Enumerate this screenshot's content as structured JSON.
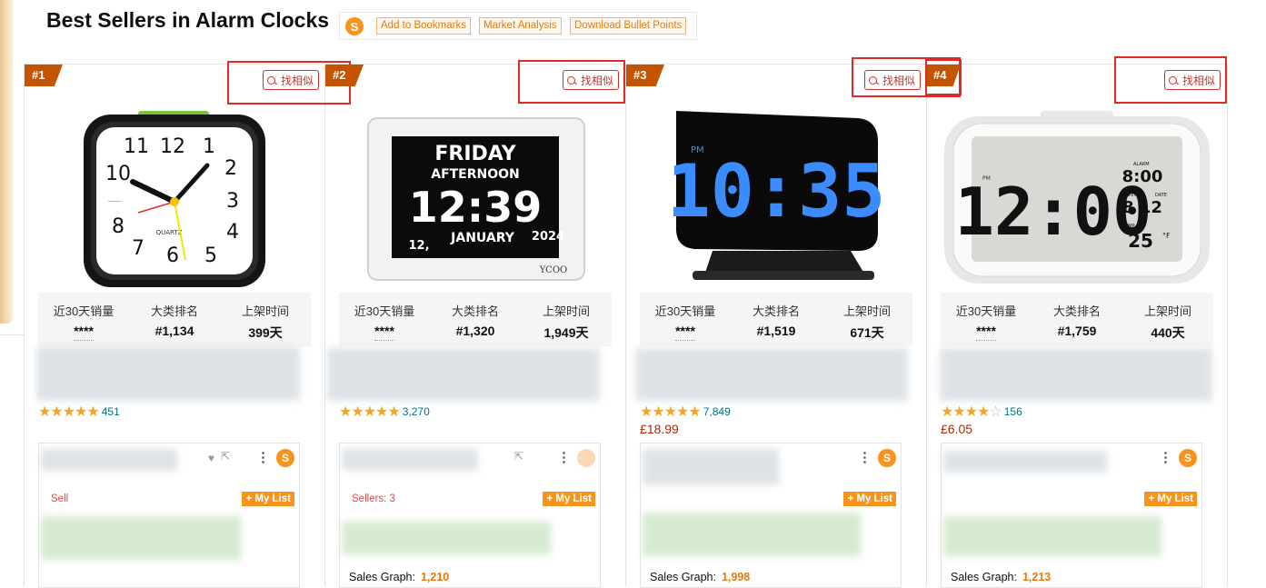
{
  "page": {
    "title": "Best Sellers in Alarm Clocks"
  },
  "toolbar": {
    "logo_icon": "seller-tool-logo-icon",
    "buttons": [
      "Add to Bookmarks",
      "Market Analysis",
      "Download Bullet Points"
    ]
  },
  "colors": {
    "accent_orange": "#f7941d",
    "rank_badge": "#c45500",
    "highlight_red": "#e02b2b",
    "price_red": "#b12704",
    "star_color": "#f5a623"
  },
  "stat_labels": [
    "近30天销量",
    "大类排名",
    "上架时间"
  ],
  "similar_label": "找相似",
  "sales_graph_label": "Sales Graph:",
  "mylist_label": "+ My List",
  "products": [
    {
      "rank": "#1",
      "sales_30d": "****",
      "category_rank": "#1,134",
      "listed_time": "399天",
      "rating": 4.5,
      "stars": "★★★★★",
      "reviews": "451",
      "price": "",
      "sellers": "Sell",
      "sales_graph": ""
    },
    {
      "rank": "#2",
      "sales_30d": "****",
      "category_rank": "#1,320",
      "listed_time": "1,949天",
      "rating": 4.5,
      "stars": "★★★★★",
      "reviews": "3,270",
      "price": "",
      "sellers": "Sellers: 3",
      "sales_graph": "1,210"
    },
    {
      "rank": "#3",
      "sales_30d": "****",
      "category_rank": "#1,519",
      "listed_time": "671天",
      "rating": 4.5,
      "stars": "★★★★★",
      "reviews": "7,849",
      "price": "£18.99",
      "sellers": "",
      "sales_graph": "1,998"
    },
    {
      "rank": "#4",
      "sales_30d": "****",
      "category_rank": "#1,759",
      "listed_time": "440天",
      "rating": 4.0,
      "stars": "★★★★",
      "reviews": "156",
      "price": "£6.05",
      "sellers": "",
      "sales_graph": "1,213"
    }
  ],
  "clock_images": {
    "p1": {
      "numbers": [
        "12",
        "1",
        "2",
        "3",
        "4",
        "5",
        "6",
        "7",
        "8",
        "9",
        "10",
        "11"
      ],
      "brand": "QUARTZ"
    },
    "p2": {
      "day": "FRIDAY",
      "period": "AFTERNOON",
      "time": "12:39",
      "day_num": "12,",
      "month": "JANUARY",
      "year": "2024",
      "brand": "YCOO"
    },
    "p3": {
      "pm": "PM",
      "time": "10:35"
    },
    "p4": {
      "time": "12:00",
      "pm": "PM",
      "alarm": "ALARM",
      "alarm_time": "8:00",
      "month": "MONTH",
      "date": "DATE",
      "date_value": "8 12",
      "temp": "TEMP",
      "temp_value": "25",
      "unit": "°F"
    }
  }
}
